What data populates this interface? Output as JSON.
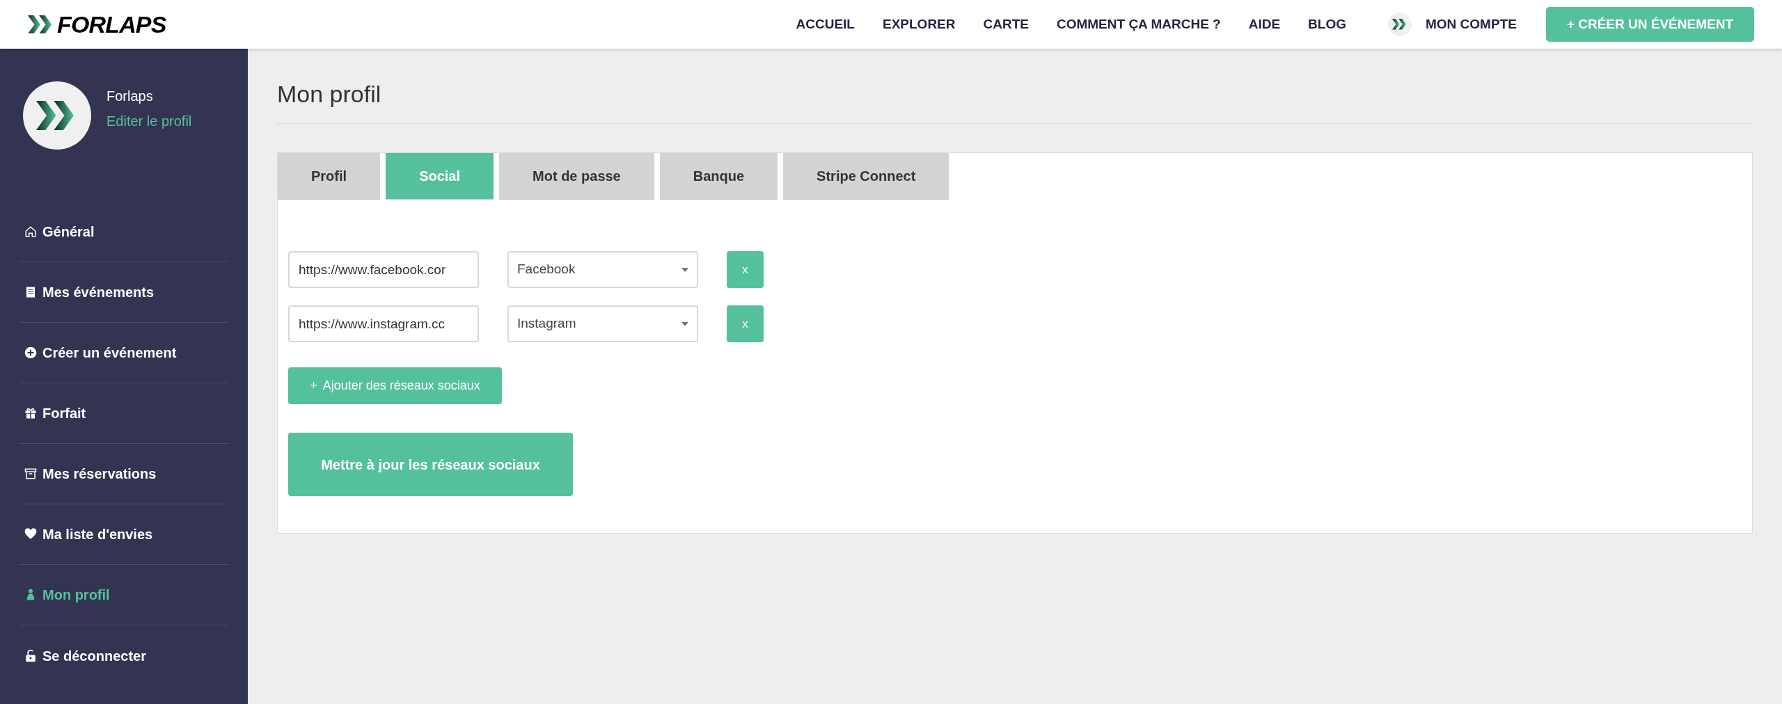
{
  "header": {
    "brand": "FORLAPS",
    "nav": [
      "ACCUEIL",
      "EXPLORER",
      "CARTE",
      "COMMENT ÇA MARCHE ?",
      "AIDE",
      "BLOG"
    ],
    "account": "MON COMPTE",
    "cta": "+ CRÉER UN ÉVÉNEMENT"
  },
  "sidebar": {
    "user_name": "Forlaps",
    "edit_link": "Editer le profil",
    "items": [
      {
        "label": "Général",
        "selected": false
      },
      {
        "label": "Mes événements",
        "selected": false
      },
      {
        "label": "Créer un événement",
        "selected": false
      },
      {
        "label": "Forfait",
        "selected": false
      },
      {
        "label": "Mes réservations",
        "selected": false
      },
      {
        "label": "Ma liste d'envies",
        "selected": false
      },
      {
        "label": "Mon profil",
        "selected": true
      },
      {
        "label": "Se déconnecter",
        "selected": false
      }
    ]
  },
  "page": {
    "title": "Mon profil",
    "tabs": [
      {
        "label": "Profil",
        "selected": false
      },
      {
        "label": "Social",
        "selected": true
      },
      {
        "label": "Mot de passe",
        "selected": false
      },
      {
        "label": "Banque",
        "selected": false
      },
      {
        "label": "Stripe Connect",
        "selected": false
      }
    ],
    "social_links": [
      {
        "url": "https://www.facebook.cor",
        "network": "Facebook",
        "remove": "x"
      },
      {
        "url": "https://www.instagram.cc",
        "network": "Instagram",
        "remove": "x"
      }
    ],
    "add_button": "Ajouter des réseaux sociaux",
    "add_icon": "+",
    "submit_button": "Mettre à jour les réseaux sociaux"
  }
}
